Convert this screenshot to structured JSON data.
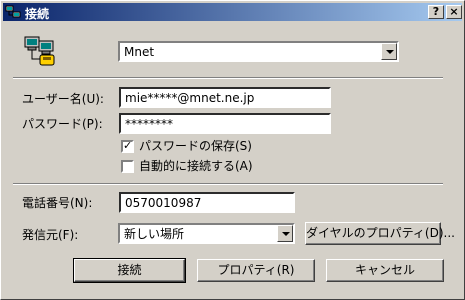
{
  "window": {
    "title": "接続",
    "help_button": "?",
    "close_button": "×"
  },
  "connection": {
    "selected": "Mnet"
  },
  "fields": {
    "user_label": "ユーザー名(U):",
    "user_value": "mie*****@mnet.ne.jp",
    "password_label": "パスワード(P):",
    "password_value": "********",
    "save_password_label": "パスワードの保存(S)",
    "auto_connect_label": "自動的に接続する(A)",
    "phone_label": "電話番号(N):",
    "phone_value": "0570010987",
    "dialfrom_label": "発信元(F):",
    "dialfrom_value": "新しい場所",
    "dial_props_button": "ダイヤルのプロパティ(D)..."
  },
  "checkboxes": {
    "save_password": true,
    "auto_connect": false
  },
  "buttons": {
    "connect": "接続",
    "properties": "プロパティ(R)",
    "cancel": "キャンセル"
  },
  "icons": {
    "title_icon": "network-connection-icon",
    "main_icon": "dialup-connection-icon"
  }
}
